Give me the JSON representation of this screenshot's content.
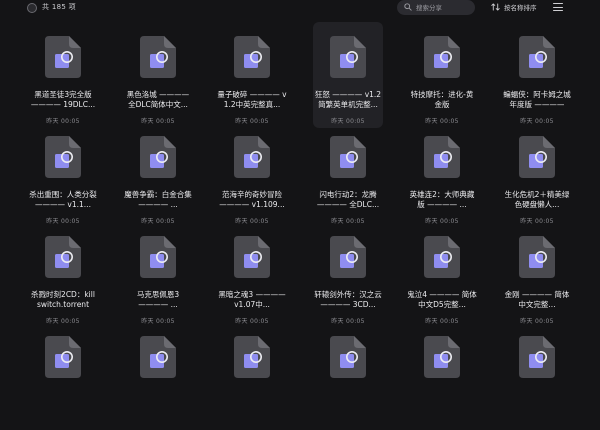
{
  "header": {
    "count_label": "共 185 项",
    "search_placeholder": "搜索分享",
    "sort_label": "按名称排序"
  },
  "files": [
    {
      "name": "黑道圣徒3完全版———— 19DLC...",
      "date": "昨天 00:05"
    },
    {
      "name": "黑色洛城 ———— 全DLC简体中文...",
      "date": "昨天 00:05"
    },
    {
      "name": "量子破碎 ———— v1.2中英完整真...",
      "date": "昨天 00:05"
    },
    {
      "name": "狂怒 ———— v1.2 简繁英单机完整...",
      "date": "昨天 00:05",
      "selected": true
    },
    {
      "name": "特技摩托：进化-黄金版",
      "date": "昨天 00:05"
    },
    {
      "name": "蝙蝠侠：阿卡姆之城年度版 ————",
      "date": "昨天 00:05"
    },
    {
      "name": "杀出重围：人类分裂 ———— v1.1...",
      "date": "昨天 00:05"
    },
    {
      "name": "魔兽争霸：白金合集 ———— ...",
      "date": "昨天 00:05"
    },
    {
      "name": "范海辛的奇妙冒险 ———— v1.109...",
      "date": "昨天 00:05"
    },
    {
      "name": "闪电行动2：龙腾 ———— 全DLC...",
      "date": "昨天 00:05"
    },
    {
      "name": "英雄连2：大师典藏版 ———— ...",
      "date": "昨天 00:05"
    },
    {
      "name": "生化危机2＋精美绿色硬盘懒人...",
      "date": "昨天 00:05"
    },
    {
      "name": "杀戮时刻2CD：kill switch.torrent",
      "date": "昨天 00:05"
    },
    {
      "name": "马克思佩恩3 ———— ...",
      "date": "昨天 00:05"
    },
    {
      "name": "黑暗之魂3 ———— v1.07中...",
      "date": "昨天 00:05"
    },
    {
      "name": "轩辕剑外传：汉之云 ———— 3CD...",
      "date": "昨天 00:05"
    },
    {
      "name": "鬼泣4 ———— 简体中文D5完整...",
      "date": "昨天 00:05"
    },
    {
      "name": "金刚 ———— 简体中文完整...",
      "date": "昨天 00:05"
    },
    {
      "name": "",
      "date": ""
    },
    {
      "name": "",
      "date": ""
    },
    {
      "name": "",
      "date": ""
    },
    {
      "name": "",
      "date": ""
    },
    {
      "name": "",
      "date": ""
    },
    {
      "name": "",
      "date": ""
    }
  ]
}
